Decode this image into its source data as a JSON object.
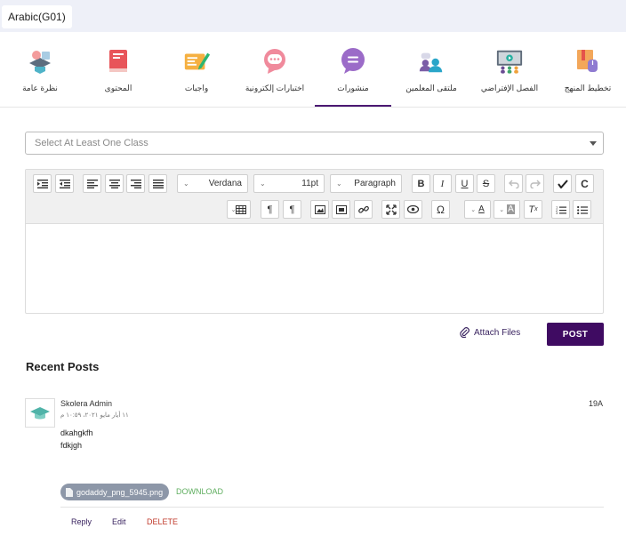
{
  "class_selector": {
    "label": "Arabic(G01)"
  },
  "tabs": [
    {
      "label": "تخطيط المنهج",
      "icon": "curriculum-icon"
    },
    {
      "label": "الفصل الإفتراضي",
      "icon": "virtual-class-icon"
    },
    {
      "label": "ملتقى المعلمين",
      "icon": "teachers-forum-icon"
    },
    {
      "label": "منشورات",
      "icon": "posts-icon",
      "active": true
    },
    {
      "label": "اختبارات إلكترونية",
      "icon": "e-tests-icon"
    },
    {
      "label": "واجبات",
      "icon": "assignments-icon"
    },
    {
      "label": "المحتوى",
      "icon": "content-book-icon"
    },
    {
      "label": "نظرة عامة",
      "icon": "overview-icon"
    }
  ],
  "class_dropdown": {
    "placeholder": "Select At Least One Class"
  },
  "editor": {
    "font_family": "Verdana",
    "font_size": "11pt",
    "block_format": "Paragraph",
    "bold": "B",
    "italic": "I",
    "underline": "U",
    "strikethrough": "S",
    "clear_label": "C",
    "omega": "Ω",
    "font_color_label": "A",
    "highlight_label": "A"
  },
  "attach_files": "Attach Files",
  "post_button": "POST",
  "recent_posts": {
    "heading": "Recent Posts",
    "posts": [
      {
        "author": "Skolera Admin",
        "date": "١١ أيار مايو ٢٠٢١، ١٠:٥٩ م",
        "time": "19A",
        "lines": [
          "dkahgkfh",
          "fdkjgh"
        ],
        "attachment": "godaddy_png_5945.png",
        "download": "DOWNLOAD",
        "actions": {
          "reply": "Reply",
          "edit": "Edit",
          "delete": "DELETE"
        }
      }
    ]
  },
  "colors": {
    "accent": "#3f0b62",
    "topbar": "#eef0f8",
    "download": "#5fae5f",
    "delete": "#c0392b",
    "chip": "#8d97a8"
  }
}
